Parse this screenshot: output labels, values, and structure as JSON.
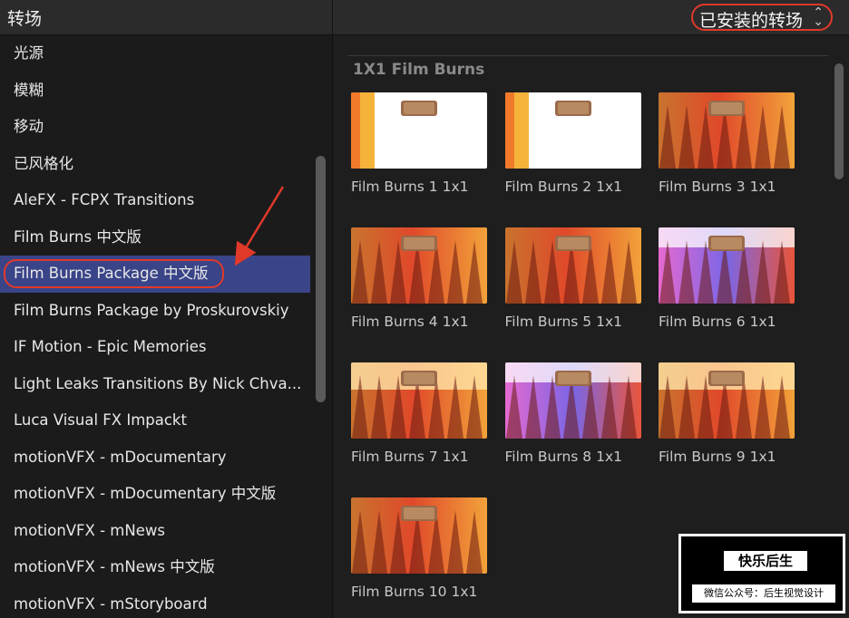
{
  "header": {
    "title": "转场",
    "dropdown_label": "已安装的转场",
    "dropdown_icon": "chevron-up-down-icon"
  },
  "sidebar": {
    "items": [
      {
        "label": "光源"
      },
      {
        "label": "模糊"
      },
      {
        "label": "移动"
      },
      {
        "label": "已风格化"
      },
      {
        "label": "AleFX - FCPX Transitions"
      },
      {
        "label": "Film Burns 中文版"
      },
      {
        "label": "Film Burns Package 中文版",
        "selected": true
      },
      {
        "label": "Film Burns Package by Proskurovskiy"
      },
      {
        "label": "IF Motion - Epic Memories"
      },
      {
        "label": "Light Leaks Transitions By Nick Chva..."
      },
      {
        "label": "Luca Visual FX Impackt"
      },
      {
        "label": "motionVFX - mDocumentary"
      },
      {
        "label": "motionVFX - mDocumentary 中文版"
      },
      {
        "label": "motionVFX - mNews"
      },
      {
        "label": "motionVFX - mNews 中文版"
      },
      {
        "label": "motionVFX - mStoryboard"
      }
    ]
  },
  "grid": {
    "section_title": "1X1 Film Burns",
    "tiles": [
      {
        "label": "Film Burns 1 1x1",
        "style": "white"
      },
      {
        "label": "Film Burns 2 1x1",
        "style": "white"
      },
      {
        "label": "Film Burns 3 1x1",
        "style": "trees"
      },
      {
        "label": "Film Burns 4 1x1",
        "style": "trees"
      },
      {
        "label": "Film Burns 5 1x1",
        "style": "trees"
      },
      {
        "label": "Film Burns 6 1x1",
        "style": "purple"
      },
      {
        "label": "Film Burns 7 1x1",
        "style": "trees-top"
      },
      {
        "label": "Film Burns 8 1x1",
        "style": "purple"
      },
      {
        "label": "Film Burns 9 1x1",
        "style": "trees-top"
      },
      {
        "label": "Film Burns 10 1x1",
        "style": "trees"
      }
    ]
  },
  "watermark": {
    "title": "快乐后生",
    "subtitle": "微信公众号：后生视觉设计"
  },
  "colors": {
    "accent_ring": "#e0392a",
    "selection": "#3a4488"
  }
}
